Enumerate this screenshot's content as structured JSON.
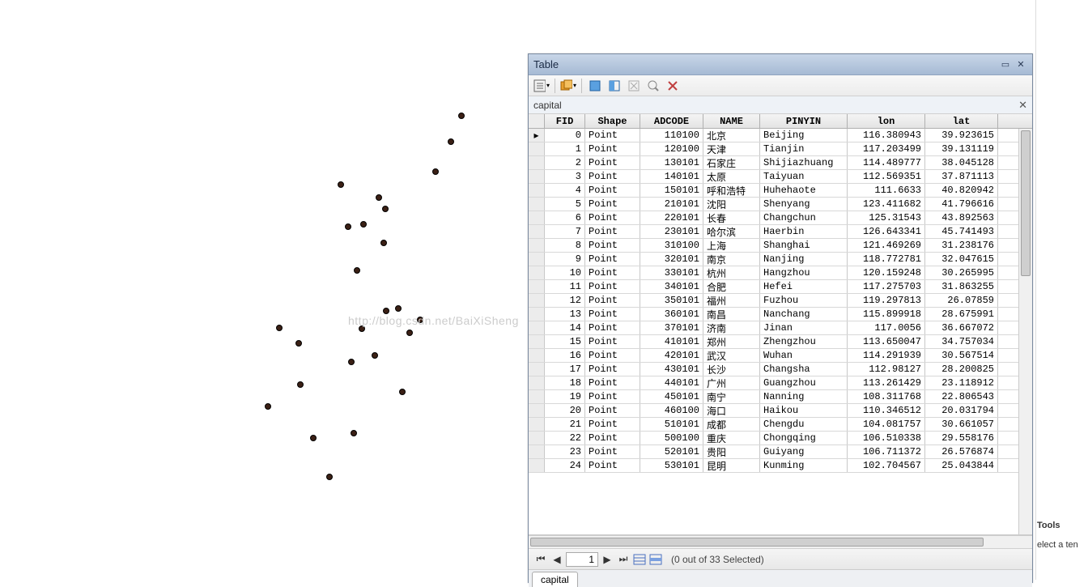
{
  "window": {
    "title": "Table",
    "subtitle": "capital",
    "tab": "capital",
    "nav_value": "1",
    "status": "(0 out of 33 Selected)"
  },
  "watermark": "http://blog.csdn.net/BaiXiSheng",
  "columns": [
    "FID",
    "Shape",
    "ADCODE",
    "NAME",
    "PINYIN",
    "lon",
    "lat"
  ],
  "rows": [
    {
      "fid": "0",
      "shape": "Point",
      "adcode": "110100",
      "name": "北京",
      "pinyin": "Beijing",
      "lon": "116.380943",
      "lat": "39.923615"
    },
    {
      "fid": "1",
      "shape": "Point",
      "adcode": "120100",
      "name": "天津",
      "pinyin": "Tianjin",
      "lon": "117.203499",
      "lat": "39.131119"
    },
    {
      "fid": "2",
      "shape": "Point",
      "adcode": "130101",
      "name": "石家庄",
      "pinyin": "Shijiazhuang",
      "lon": "114.489777",
      "lat": "38.045128"
    },
    {
      "fid": "3",
      "shape": "Point",
      "adcode": "140101",
      "name": "太原",
      "pinyin": "Taiyuan",
      "lon": "112.569351",
      "lat": "37.871113"
    },
    {
      "fid": "4",
      "shape": "Point",
      "adcode": "150101",
      "name": "呼和浩特",
      "pinyin": "Huhehaote",
      "lon": "111.6633",
      "lat": "40.820942"
    },
    {
      "fid": "5",
      "shape": "Point",
      "adcode": "210101",
      "name": "沈阳",
      "pinyin": "Shenyang",
      "lon": "123.411682",
      "lat": "41.796616"
    },
    {
      "fid": "6",
      "shape": "Point",
      "adcode": "220101",
      "name": "长春",
      "pinyin": "Changchun",
      "lon": "125.31543",
      "lat": "43.892563"
    },
    {
      "fid": "7",
      "shape": "Point",
      "adcode": "230101",
      "name": "哈尔滨",
      "pinyin": "Haerbin",
      "lon": "126.643341",
      "lat": "45.741493"
    },
    {
      "fid": "8",
      "shape": "Point",
      "adcode": "310100",
      "name": "上海",
      "pinyin": "Shanghai",
      "lon": "121.469269",
      "lat": "31.238176"
    },
    {
      "fid": "9",
      "shape": "Point",
      "adcode": "320101",
      "name": "南京",
      "pinyin": "Nanjing",
      "lon": "118.772781",
      "lat": "32.047615"
    },
    {
      "fid": "10",
      "shape": "Point",
      "adcode": "330101",
      "name": "杭州",
      "pinyin": "Hangzhou",
      "lon": "120.159248",
      "lat": "30.265995"
    },
    {
      "fid": "11",
      "shape": "Point",
      "adcode": "340101",
      "name": "合肥",
      "pinyin": "Hefei",
      "lon": "117.275703",
      "lat": "31.863255"
    },
    {
      "fid": "12",
      "shape": "Point",
      "adcode": "350101",
      "name": "福州",
      "pinyin": "Fuzhou",
      "lon": "119.297813",
      "lat": "26.07859"
    },
    {
      "fid": "13",
      "shape": "Point",
      "adcode": "360101",
      "name": "南昌",
      "pinyin": "Nanchang",
      "lon": "115.899918",
      "lat": "28.675991"
    },
    {
      "fid": "14",
      "shape": "Point",
      "adcode": "370101",
      "name": "济南",
      "pinyin": "Jinan",
      "lon": "117.0056",
      "lat": "36.667072"
    },
    {
      "fid": "15",
      "shape": "Point",
      "adcode": "410101",
      "name": "郑州",
      "pinyin": "Zhengzhou",
      "lon": "113.650047",
      "lat": "34.757034"
    },
    {
      "fid": "16",
      "shape": "Point",
      "adcode": "420101",
      "name": "武汉",
      "pinyin": "Wuhan",
      "lon": "114.291939",
      "lat": "30.567514"
    },
    {
      "fid": "17",
      "shape": "Point",
      "adcode": "430101",
      "name": "长沙",
      "pinyin": "Changsha",
      "lon": "112.98127",
      "lat": "28.200825"
    },
    {
      "fid": "18",
      "shape": "Point",
      "adcode": "440101",
      "name": "广州",
      "pinyin": "Guangzhou",
      "lon": "113.261429",
      "lat": "23.118912"
    },
    {
      "fid": "19",
      "shape": "Point",
      "adcode": "450101",
      "name": "南宁",
      "pinyin": "Nanning",
      "lon": "108.311768",
      "lat": "22.806543"
    },
    {
      "fid": "20",
      "shape": "Point",
      "adcode": "460100",
      "name": "海口",
      "pinyin": "Haikou",
      "lon": "110.346512",
      "lat": "20.031794"
    },
    {
      "fid": "21",
      "shape": "Point",
      "adcode": "510101",
      "name": "成都",
      "pinyin": "Chengdu",
      "lon": "104.081757",
      "lat": "30.661057"
    },
    {
      "fid": "22",
      "shape": "Point",
      "adcode": "500100",
      "name": "重庆",
      "pinyin": "Chongqing",
      "lon": "106.510338",
      "lat": "29.558176"
    },
    {
      "fid": "23",
      "shape": "Point",
      "adcode": "520101",
      "name": "贵阳",
      "pinyin": "Guiyang",
      "lon": "106.711372",
      "lat": "26.576874"
    },
    {
      "fid": "24",
      "shape": "Point",
      "adcode": "530101",
      "name": "昆明",
      "pinyin": "Kunming",
      "lon": "102.704567",
      "lat": "25.043844"
    }
  ],
  "sidebar": {
    "title": "Tools",
    "hint": "elect a ten"
  },
  "chart_data": {
    "type": "scatter",
    "title": "",
    "series": [
      {
        "name": "capital",
        "x": [
          116.380943,
          117.203499,
          114.489777,
          112.569351,
          111.6633,
          123.411682,
          125.31543,
          126.643341,
          121.469269,
          118.772781,
          120.159248,
          117.275703,
          119.297813,
          115.899918,
          117.0056,
          113.650047,
          114.291939,
          112.98127,
          113.261429,
          108.311768,
          110.346512,
          104.081757,
          106.510338,
          106.711372,
          102.704567
        ],
        "y": [
          39.923615,
          39.131119,
          38.045128,
          37.871113,
          40.820942,
          41.796616,
          43.892563,
          45.741493,
          31.238176,
          32.047615,
          30.265995,
          31.863255,
          26.07859,
          28.675991,
          36.667072,
          34.757034,
          30.567514,
          28.200825,
          23.118912,
          22.806543,
          20.031794,
          30.661057,
          29.558176,
          26.576874,
          25.043844
        ]
      }
    ],
    "xlim": [
      75,
      135
    ],
    "ylim": [
      18,
      48
    ]
  }
}
